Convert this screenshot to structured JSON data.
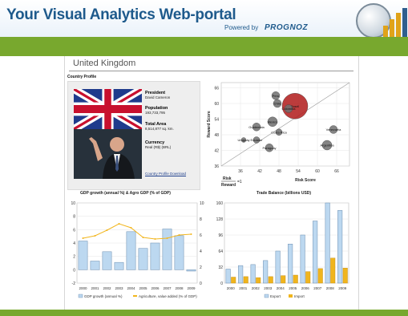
{
  "header": {
    "title": "Your Visual Analytics Web-portal",
    "powered_by": "Powered by",
    "brand": "PROGNOZ"
  },
  "country": {
    "name": "United Kingdom",
    "profile_label": "Country Profile",
    "president_label": "President",
    "president_value": "David Cameron",
    "population_label": "Population",
    "population_value": "193,733,795",
    "area_label": "Total Area",
    "area_value": "8,514,877 sq. km.",
    "currency_label": "Currency",
    "currency_value": "Real (R$) (BRL)",
    "download_link": "Country Profile Download"
  },
  "colors": {
    "header_blue": "#1e5a8c",
    "accent_green": "#78a82e",
    "bubble_red": "#b01a1a",
    "bubble_gray": "#6e6e6e",
    "bar_blue": "#bcd8f0",
    "line_orange": "#f2b61e",
    "import_orange": "#f0b51d"
  },
  "charts_titles": {
    "gdp": "GDP growth (annual %) & Agro GDP (% of GDP)",
    "trade": "Trade Balance (billions USD)"
  },
  "risk_legend": {
    "risk": "Risk",
    "reward": "Reward",
    "eq": "=1"
  },
  "chart_data": [
    {
      "type": "scatter",
      "name_hint": "risk-reward bubble chart",
      "xlabel": "Risk Score",
      "ylabel": "Reward Score",
      "xlim": [
        30,
        70
      ],
      "ylim": [
        36,
        68
      ],
      "xticks": [
        36,
        42,
        48,
        54,
        60,
        66
      ],
      "yticks": [
        36,
        42,
        48,
        54,
        60,
        66
      ],
      "points": [
        {
          "label": "Peru",
          "x": 47,
          "y": 63,
          "size": 5,
          "color": "gray"
        },
        {
          "label": "Chile",
          "x": 47.5,
          "y": 60,
          "size": 5,
          "color": "gray"
        },
        {
          "label": "Brazil",
          "x": 53,
          "y": 59,
          "size": 16,
          "color": "red"
        },
        {
          "label": "Colombia",
          "x": 51,
          "y": 58,
          "size": 5,
          "color": "gray"
        },
        {
          "label": "Mexico",
          "x": 46,
          "y": 53,
          "size": 6,
          "color": "gray"
        },
        {
          "label": "Guatemala",
          "x": 41,
          "y": 51,
          "size": 5,
          "color": "gray"
        },
        {
          "label": "Costa Rica",
          "x": 48,
          "y": 49,
          "size": 4,
          "color": "gray"
        },
        {
          "label": "Venezuela",
          "x": 65,
          "y": 50,
          "size": 5,
          "color": "gray"
        },
        {
          "label": "Uruguay",
          "x": 37,
          "y": 46,
          "size": 3,
          "color": "gray"
        },
        {
          "label": "Ecuador",
          "x": 41,
          "y": 46,
          "size": 4,
          "color": "gray"
        },
        {
          "label": "Argentina",
          "x": 63,
          "y": 44,
          "size": 6,
          "color": "gray"
        },
        {
          "label": "Paraguay",
          "x": 45,
          "y": 43,
          "size": 5,
          "color": "gray"
        }
      ],
      "diagonal": true
    },
    {
      "type": "bar",
      "title": "GDP growth (annual %) & Agro GDP (% of GDP)",
      "categories": [
        "2000",
        "2001",
        "2002",
        "2003",
        "2004",
        "2005",
        "2006",
        "2007",
        "2008",
        "2009"
      ],
      "series": [
        {
          "name": "GDP growth (annual %)",
          "values": [
            4.3,
            1.3,
            2.7,
            1.1,
            5.7,
            3.2,
            4.0,
            6.1,
            5.1,
            -0.2
          ]
        },
        {
          "name": "Agriculture, value added (% of GDP)",
          "values": [
            5.6,
            5.9,
            6.6,
            7.4,
            6.9,
            5.7,
            5.5,
            5.6,
            6.0,
            6.1
          ]
        }
      ],
      "y_left": {
        "ticks": [
          -2,
          0,
          2,
          4,
          6,
          8,
          10
        ],
        "lim": [
          -2,
          10
        ]
      },
      "y_right": {
        "ticks": [
          0,
          2,
          4,
          6,
          8,
          10
        ],
        "lim": [
          0,
          10
        ]
      },
      "legend": [
        "GDP growth (annual %)",
        "Agriculture, value added (% of GDP)"
      ]
    },
    {
      "type": "bar",
      "title": "Trade Balance (billions USD)",
      "categories": [
        "2000",
        "2001",
        "2002",
        "2003",
        "2004",
        "2005",
        "2006",
        "2007",
        "2008",
        "2009"
      ],
      "series": [
        {
          "name": "Export",
          "values": [
            28,
            35,
            37,
            45,
            64,
            78,
            96,
            124,
            160,
            145
          ]
        },
        {
          "name": "Import",
          "values": [
            12,
            13,
            11,
            13,
            15,
            16,
            23,
            29,
            50,
            30
          ]
        }
      ],
      "ylim": [
        0,
        160
      ],
      "yticks": [
        0,
        32,
        64,
        96,
        128,
        160
      ],
      "legend": [
        "Export",
        "Import"
      ]
    }
  ]
}
